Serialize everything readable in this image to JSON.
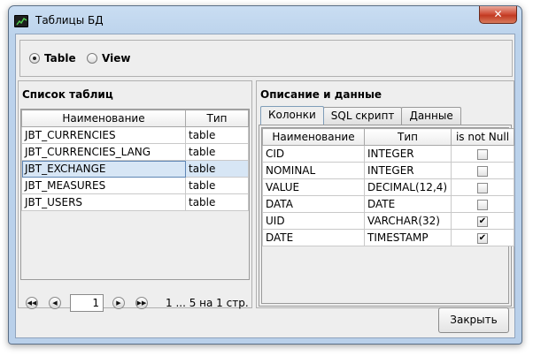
{
  "window": {
    "title": "Таблицы БД",
    "close_glyph": "✕",
    "icon": "chart-window-icon"
  },
  "view_mode": {
    "options": [
      {
        "label": "Table",
        "selected": true
      },
      {
        "label": "View",
        "selected": false
      }
    ]
  },
  "tables_panel": {
    "title": "Список таблиц",
    "columns": [
      "Наименование",
      "Тип"
    ],
    "rows": [
      {
        "name": "JBT_CURRENCIES",
        "type": "table",
        "selected": false
      },
      {
        "name": "JBT_CURRENCIES_LANG",
        "type": "table",
        "selected": false
      },
      {
        "name": "JBT_EXCHANGE",
        "type": "table",
        "selected": true
      },
      {
        "name": "JBT_MEASURES",
        "type": "table",
        "selected": false
      },
      {
        "name": "JBT_USERS",
        "type": "table",
        "selected": false
      }
    ],
    "pager": {
      "page_value": "1",
      "info": "1 ... 5 на 1 стр.",
      "first_icon": "first-page-icon",
      "prev_icon": "prev-page-icon",
      "next_icon": "next-page-icon",
      "last_icon": "last-page-icon"
    }
  },
  "details_panel": {
    "title": "Описание и данные",
    "tabs": [
      "Колонки",
      "SQL скрипт",
      "Данные"
    ],
    "active_tab": "Колонки",
    "columns": [
      "Наименование",
      "Тип",
      "is not Null"
    ],
    "rows": [
      {
        "name": "CID",
        "type": "INTEGER",
        "not_null": false
      },
      {
        "name": "NOMINAL",
        "type": "INTEGER",
        "not_null": false
      },
      {
        "name": "VALUE",
        "type": "DECIMAL(12,4)",
        "not_null": false
      },
      {
        "name": "DATA",
        "type": "DATE",
        "not_null": false
      },
      {
        "name": "UID",
        "type": "VARCHAR(32)",
        "not_null": true
      },
      {
        "name": "DATE",
        "type": "TIMESTAMP",
        "not_null": true
      }
    ]
  },
  "footer": {
    "close_label": "Закрыть"
  },
  "colors": {
    "selected_row": "#d7e6f5",
    "window_frame": "#bcd3ec",
    "close_button": "#c94a32"
  }
}
